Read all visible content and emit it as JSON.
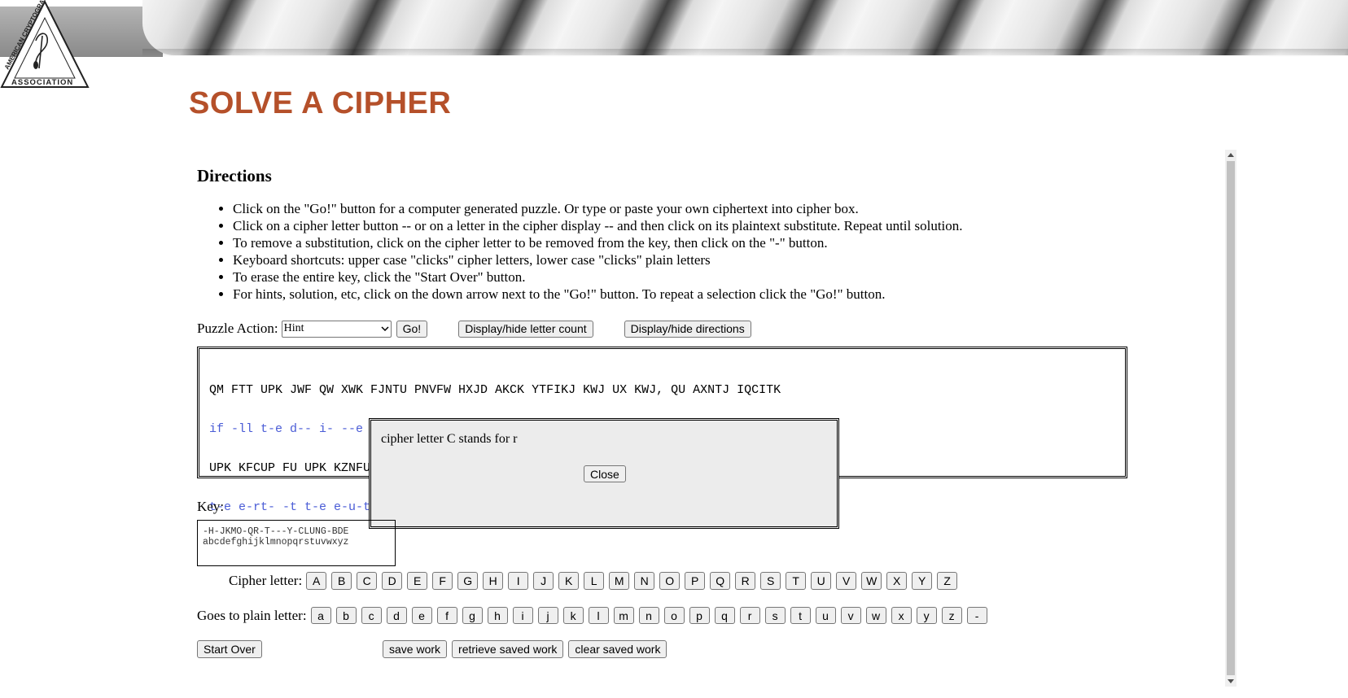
{
  "page": {
    "title": "SOLVE A CIPHER"
  },
  "logo": {
    "text_top": "AMERICAN CRYPTOGRAM",
    "text_bottom": "ASSOCIATION"
  },
  "directions": {
    "heading": "Directions",
    "items": [
      "Click on the \"Go!\" button for a computer generated puzzle. Or type or paste your own ciphertext into cipher box.",
      "Click on a cipher letter button -- or on a letter in the cipher display -- and then click on its plaintext substitute. Repeat until solution.",
      "To remove a substitution, click on the cipher letter to be removed from the key, then click on the \"-\" button.",
      "Keyboard shortcuts: upper case \"clicks\" cipher letters, lower case \"clicks\" plain letters",
      "To erase the entire key, click the \"Start Over\" button.",
      "For hints, solution, etc, click on the down arrow next to the \"Go!\" button. To repeat a selection click the \"Go!\" button."
    ]
  },
  "puzzle_action": {
    "label": "Puzzle Action:",
    "selected": "Hint",
    "go_label": "Go!",
    "letter_count_label": "Display/hide letter count",
    "directions_label": "Display/hide directions"
  },
  "cipher": {
    "lines": [
      {
        "cipher": "QM FTT UPK JWF QW XWK FJNTU PNVFW HXJD AKCK YTFIKJ KWJ UX KWJ, QU AXNTJ IQCITK",
        "plain": "if -ll t-e d-- i- --e -dult -u--- b-dy -ere pl--ed e-d t- e-d, it --uld -ir-le"
      },
      {
        "cipher": "UPK KFCUP FU UPK KZNFUXC WKFCTD MXNC VQTTQXW UQVKL.",
        "plain": "t-e e-rt- -t t-e e-u-t-r -e-rly f-ur -illi-- ti-es."
      }
    ]
  },
  "dialog": {
    "message": "cipher letter C stands for r",
    "close_label": "Close"
  },
  "key": {
    "label": "Key:",
    "cipher_row": "-H-JKMO-QR-T---Y-CLUNG-BDE",
    "plain_row": "abcdefghijklmnopqrstuvwxyz"
  },
  "cipher_letters": {
    "label": "Cipher letter:",
    "letters": [
      "A",
      "B",
      "C",
      "D",
      "E",
      "F",
      "G",
      "H",
      "I",
      "J",
      "K",
      "L",
      "M",
      "N",
      "O",
      "P",
      "Q",
      "R",
      "S",
      "T",
      "U",
      "V",
      "W",
      "X",
      "Y",
      "Z"
    ]
  },
  "plain_letters": {
    "label": "Goes to plain letter:",
    "letters": [
      "a",
      "b",
      "c",
      "d",
      "e",
      "f",
      "g",
      "h",
      "i",
      "j",
      "k",
      "l",
      "m",
      "n",
      "o",
      "p",
      "q",
      "r",
      "s",
      "t",
      "u",
      "v",
      "w",
      "x",
      "y",
      "z",
      "-"
    ]
  },
  "footer": {
    "start_over": "Start Over",
    "save_work": "save work",
    "retrieve_saved": "retrieve saved work",
    "clear_saved": "clear saved work"
  }
}
